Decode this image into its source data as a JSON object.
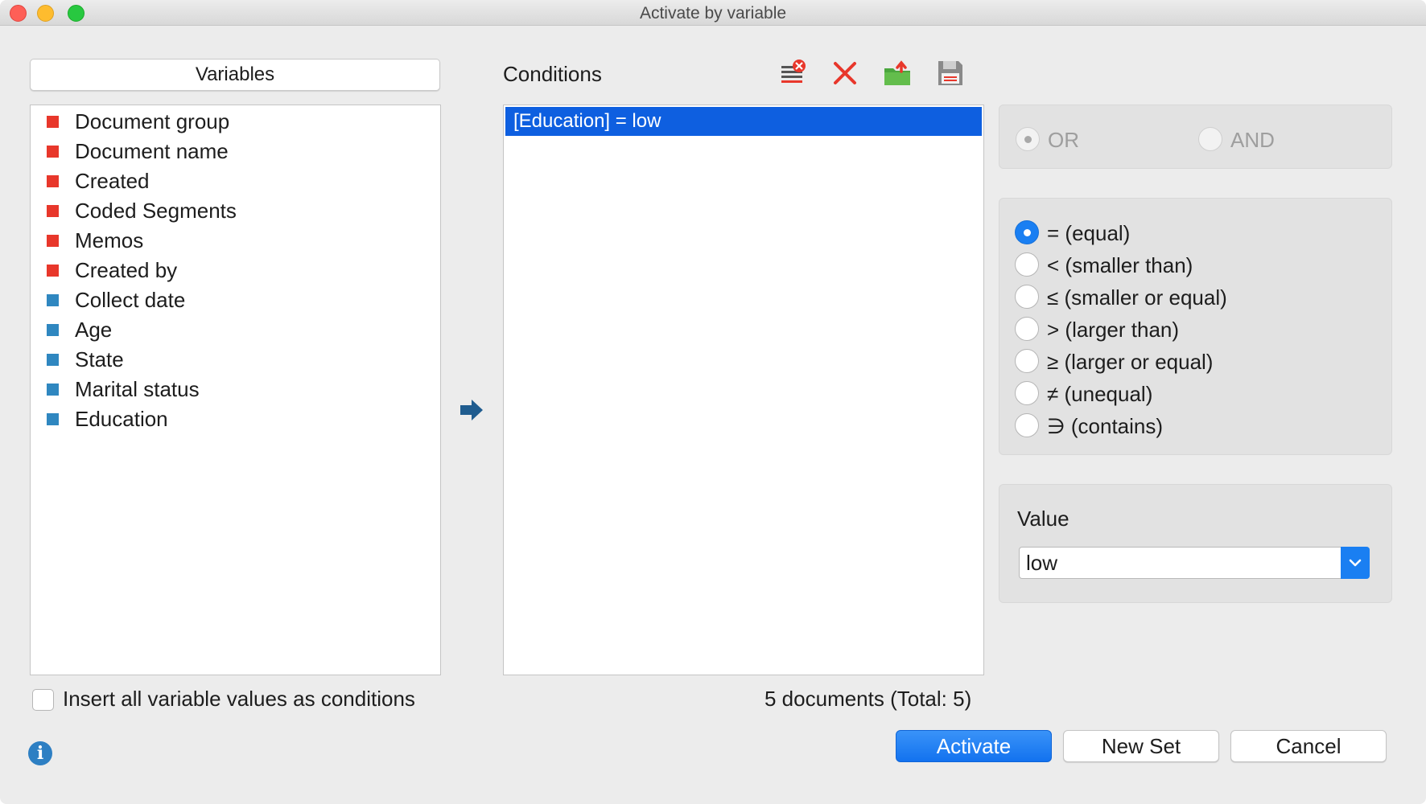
{
  "window": {
    "title": "Activate by variable"
  },
  "variables": {
    "header": "Variables",
    "items": [
      {
        "label": "Document group",
        "color": "#e8372b"
      },
      {
        "label": "Document name",
        "color": "#e8372b"
      },
      {
        "label": "Created",
        "color": "#e8372b"
      },
      {
        "label": "Coded Segments",
        "color": "#e8372b"
      },
      {
        "label": "Memos",
        "color": "#e8372b"
      },
      {
        "label": "Created by",
        "color": "#e8372b"
      },
      {
        "label": "Collect date",
        "color": "#2f87c0"
      },
      {
        "label": "Age",
        "color": "#2f87c0"
      },
      {
        "label": "State",
        "color": "#2f87c0"
      },
      {
        "label": "Marital status",
        "color": "#2f87c0"
      },
      {
        "label": "Education",
        "color": "#2f87c0"
      }
    ],
    "insert_all_label": "Insert all variable values as conditions",
    "insert_all_checked": false
  },
  "conditions": {
    "title": "Conditions",
    "rows": [
      "[Education] = low"
    ],
    "doc_count": "5 documents (Total: 5)",
    "toolbar_icons": [
      "clear-list-icon",
      "delete-icon",
      "open-folder-icon",
      "save-icon"
    ]
  },
  "logic": {
    "or_label": "OR",
    "and_label": "AND",
    "selected": "OR"
  },
  "operators": {
    "selected": "equal",
    "items": [
      {
        "key": "equal",
        "label": "= (equal)"
      },
      {
        "key": "smaller",
        "label": "< (smaller than)"
      },
      {
        "key": "smaller_equal",
        "label": "≤ (smaller or equal)"
      },
      {
        "key": "larger",
        "label": "> (larger than)"
      },
      {
        "key": "larger_equal",
        "label": "≥ (larger or equal)"
      },
      {
        "key": "unequal",
        "label": "≠ (unequal)"
      },
      {
        "key": "contains",
        "label": "∋ (contains)"
      }
    ]
  },
  "value": {
    "title": "Value",
    "selected": "low"
  },
  "buttons": {
    "activate": "Activate",
    "new_set": "New Set",
    "cancel": "Cancel"
  },
  "colors": {
    "accent": "#1a7ff2",
    "selection": "#0e5fe0",
    "system_variable": "#e8372b",
    "user_variable": "#2f87c0"
  }
}
